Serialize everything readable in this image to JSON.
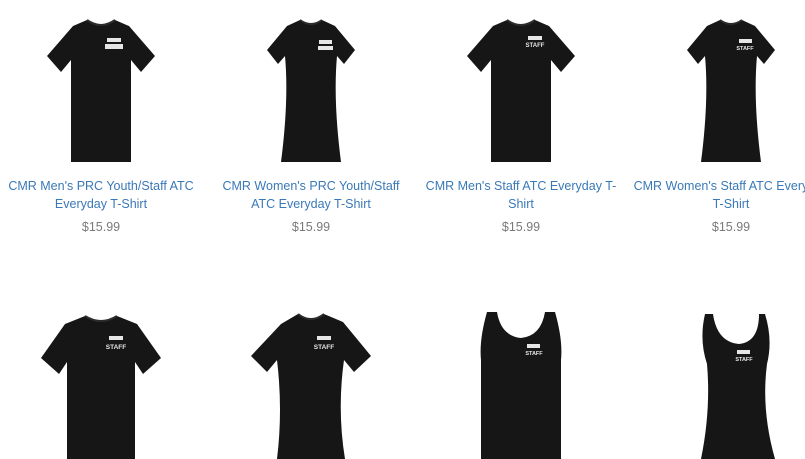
{
  "colors": {
    "link": "#3a79b8",
    "price": "#7a7a7a",
    "garment": "#161616",
    "print": "#e6e6e6"
  },
  "products": [
    {
      "title": "CMR Men's PRC Youth/Staff ATC Everyday T-Shirt",
      "price": "$15.99",
      "garment": "tshirt-men",
      "print": "logo-badge"
    },
    {
      "title": "CMR Women's PRC Youth/Staff ATC Everyday T-Shirt",
      "price": "$15.99",
      "garment": "tshirt-women",
      "print": "logo-badge"
    },
    {
      "title": "CMR Men's Staff ATC Everyday T-Shirt",
      "price": "$15.99",
      "garment": "tshirt-men",
      "print": "STAFF"
    },
    {
      "title": "CMR Women's Staff ATC Everyday T-Shirt",
      "price": "$15.99",
      "garment": "tshirt-women",
      "print": "STAFF"
    },
    {
      "title": "",
      "price": "",
      "garment": "performance-tee-men",
      "print": "STAFF"
    },
    {
      "title": "",
      "price": "",
      "garment": "performance-tee-women",
      "print": "STAFF"
    },
    {
      "title": "",
      "price": "",
      "garment": "tank-men",
      "print": "STAFF"
    },
    {
      "title": "",
      "price": "",
      "garment": "tank-women",
      "print": "STAFF"
    }
  ]
}
